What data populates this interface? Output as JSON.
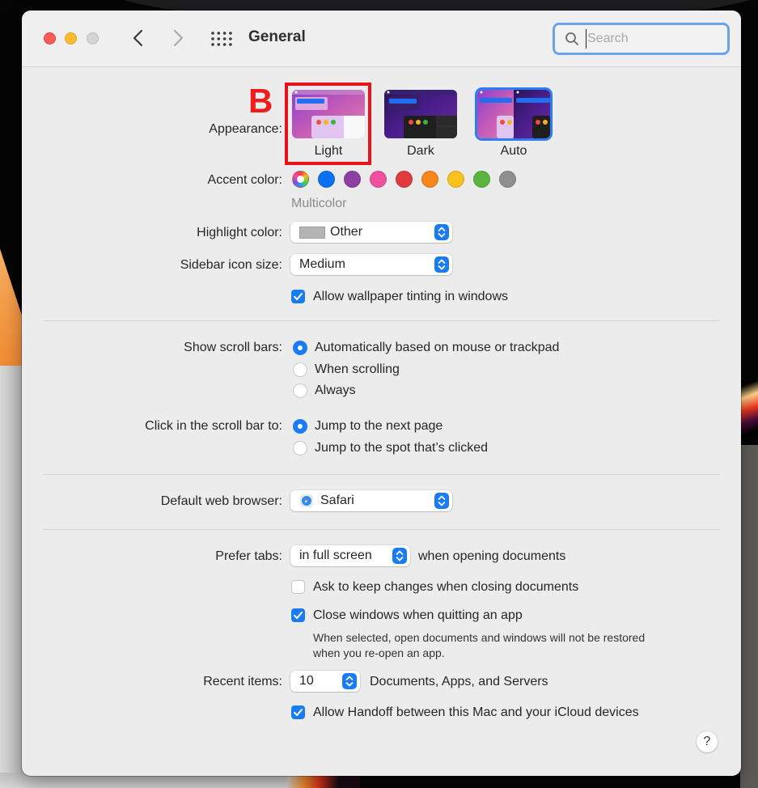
{
  "window": {
    "title": "General",
    "search": {
      "value": "",
      "placeholder": "Search"
    },
    "traffic_lights": [
      "close",
      "minimize",
      "zoom"
    ],
    "annotation_badge": "B"
  },
  "appearance": {
    "label": "Appearance:",
    "options": [
      {
        "label": "Light",
        "selected": false,
        "highlighted_by_annotation": true
      },
      {
        "label": "Dark",
        "selected": false
      },
      {
        "label": "Auto",
        "selected": true
      }
    ]
  },
  "accent": {
    "label": "Accent color:",
    "selected_name": "Multicolor",
    "colors": [
      {
        "name": "multicolor",
        "hex": "multicolor"
      },
      {
        "name": "blue",
        "hex": "#0a72f2"
      },
      {
        "name": "purple",
        "hex": "#8e3fa3"
      },
      {
        "name": "pink",
        "hex": "#f0509d"
      },
      {
        "name": "red",
        "hex": "#e23b3f"
      },
      {
        "name": "orange",
        "hex": "#f7861d"
      },
      {
        "name": "yellow",
        "hex": "#fbc21e"
      },
      {
        "name": "green",
        "hex": "#5bb440"
      },
      {
        "name": "graphite",
        "hex": "#8f8f8f"
      }
    ]
  },
  "highlight": {
    "label": "Highlight color:",
    "value": "Other",
    "swatch_hex": "#b4b4b4"
  },
  "sidebar_icon_size": {
    "label": "Sidebar icon size:",
    "value": "Medium"
  },
  "wallpaper_tinting": {
    "label": "Allow wallpaper tinting in windows",
    "checked": true
  },
  "scroll_bars": {
    "label": "Show scroll bars:",
    "options": [
      {
        "label": "Automatically based on mouse or trackpad",
        "selected": true
      },
      {
        "label": "When scrolling",
        "selected": false
      },
      {
        "label": "Always",
        "selected": false
      }
    ]
  },
  "click_scroll": {
    "label": "Click in the scroll bar to:",
    "options": [
      {
        "label": "Jump to the next page",
        "selected": true
      },
      {
        "label": "Jump to the spot that’s clicked",
        "selected": false
      }
    ]
  },
  "browser": {
    "label": "Default web browser:",
    "value": "Safari"
  },
  "prefer_tabs": {
    "label": "Prefer tabs:",
    "value": "in full screen",
    "suffix": "when opening documents"
  },
  "ask_keep_changes": {
    "label": "Ask to keep changes when closing documents",
    "checked": false
  },
  "close_windows": {
    "label": "Close windows when quitting an app",
    "checked": true,
    "note_line1": "When selected, open documents and windows will not be restored",
    "note_line2": "when you re-open an app."
  },
  "recent_items": {
    "label": "Recent items:",
    "value": "10",
    "suffix": "Documents, Apps, and Servers"
  },
  "handoff": {
    "label": "Allow Handoff between this Mac and your iCloud devices",
    "checked": true
  },
  "help": {
    "label": "?"
  }
}
